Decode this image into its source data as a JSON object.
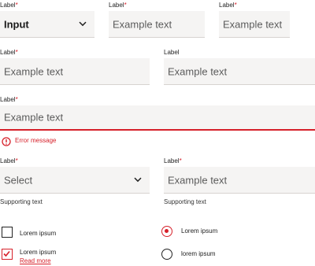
{
  "required_marker": "*",
  "colors": {
    "accent": "#d6202a",
    "field_bg": "#f5f4f3",
    "text": "#1a1a1a"
  },
  "row1": {
    "select": {
      "label": "Label",
      "value": "Input",
      "icon": "chevron-down-icon"
    },
    "text_a": {
      "label": "Label",
      "placeholder": "Example text"
    },
    "text_b": {
      "label": "Label",
      "placeholder": "Example text"
    }
  },
  "row2": {
    "text_a": {
      "label": "Label",
      "placeholder": "Example text"
    },
    "text_b": {
      "label": "Label",
      "placeholder": "Example text"
    }
  },
  "row3": {
    "text": {
      "label": "Label",
      "placeholder": "Example text"
    },
    "error": {
      "icon": "error-icon",
      "message": "Error message"
    }
  },
  "row4": {
    "select": {
      "label": "Label",
      "placeholder": "Select",
      "icon": "chevron-down-icon",
      "supporting": "Supporting text"
    },
    "text": {
      "label": "Label",
      "placeholder": "Example text",
      "supporting": "Supporting text"
    }
  },
  "checkboxes": [
    {
      "label": "Lorem ipsum",
      "checked": false
    },
    {
      "label": "Lorem ipsum",
      "checked": true,
      "link": "Read more"
    }
  ],
  "radios": [
    {
      "label": "Lorem ipsum",
      "checked": true
    },
    {
      "label": "lorem ipsum",
      "checked": false
    }
  ]
}
